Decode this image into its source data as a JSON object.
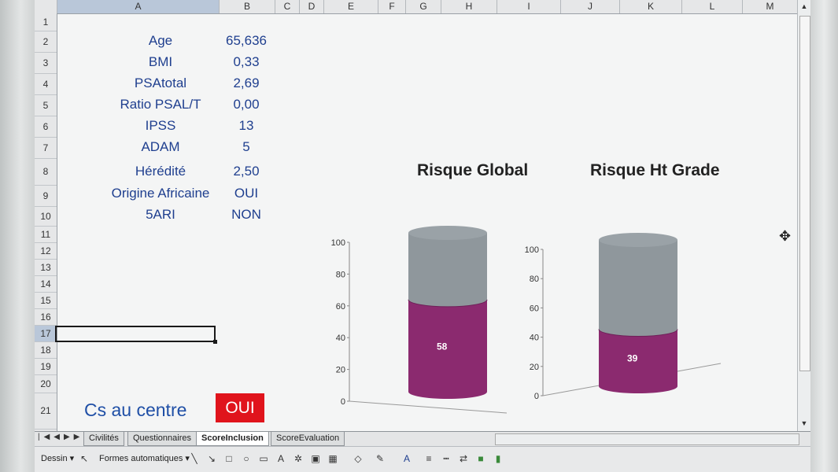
{
  "columns": [
    "A",
    "B",
    "C",
    "D",
    "E",
    "F",
    "G",
    "H",
    "I",
    "J",
    "K",
    "L",
    "M"
  ],
  "rows": [
    "1",
    "2",
    "3",
    "4",
    "5",
    "6",
    "7",
    "8",
    "9",
    "10",
    "11",
    "12",
    "13",
    "14",
    "15",
    "16",
    "17",
    "18",
    "19",
    "20",
    "21"
  ],
  "cells": [
    {
      "label": "Age",
      "value": "65,636"
    },
    {
      "label": "BMI",
      "value": "0,33"
    },
    {
      "label": "PSAtotal",
      "value": "2,69"
    },
    {
      "label": "Ratio PSAL/T",
      "value": "0,00"
    },
    {
      "label": "IPSS",
      "value": "13"
    },
    {
      "label": "ADAM",
      "value": "5"
    },
    {
      "label": "Hérédité",
      "value": "2,50"
    },
    {
      "label": "Origine Africaine",
      "value": "OUI"
    },
    {
      "label": "5ARI",
      "value": "NON"
    }
  ],
  "cs_centre": {
    "label": "Cs au centre",
    "value": "OUI"
  },
  "chart_data": [
    {
      "type": "bar",
      "title": "Risque Global",
      "categories": [
        ""
      ],
      "values": [
        58
      ],
      "ylim": [
        0,
        100
      ],
      "yticks": [
        "0",
        "20",
        "40",
        "60",
        "80",
        "100"
      ],
      "data_label": "58",
      "colors": [
        "#8b2a6f",
        "#8f979c"
      ]
    },
    {
      "type": "bar",
      "title": "Risque Ht Grade",
      "categories": [
        ""
      ],
      "values": [
        39
      ],
      "ylim": [
        0,
        100
      ],
      "yticks": [
        "0",
        "20",
        "40",
        "60",
        "80",
        "100"
      ],
      "data_label": "39",
      "colors": [
        "#8b2a6f",
        "#8f979c"
      ]
    }
  ],
  "sheet_tabs": [
    "Civilités",
    "Questionnaires",
    "ScoreInclusion",
    "ScoreEvaluation"
  ],
  "active_tab": "ScoreInclusion",
  "toolbar": {
    "dessin": "Dessin ▾",
    "formes": "Formes automatiques ▾"
  }
}
